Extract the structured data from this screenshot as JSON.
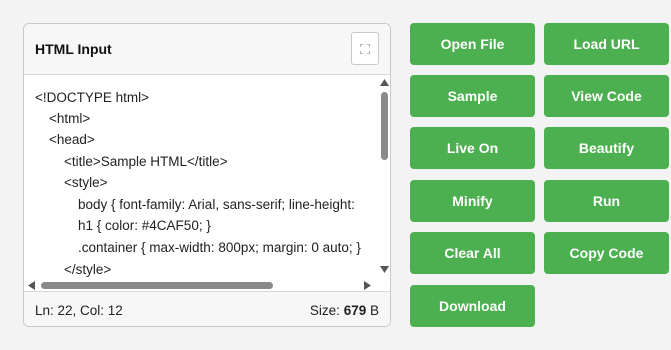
{
  "editor_panel": {
    "title": "HTML Input",
    "code_lines": [
      "<!DOCTYPE html>",
      "<html>",
      "<head>",
      "<title>Sample HTML</title>",
      "<style>",
      "body { font-family: Arial, sans-serif; line-height:",
      "h1 { color: #4CAF50; }",
      ".container { max-width: 800px; margin: 0 auto; }",
      "</style>"
    ],
    "status": {
      "cursor": "Ln: 22, Col: 12",
      "size_label": "Size:",
      "size_value": "679",
      "size_unit": "B"
    },
    "scroll": {
      "vertical_fraction": 0.0,
      "horizontal_fraction": 0.0
    }
  },
  "actions": {
    "open_file": "Open File",
    "load_url": "Load URL",
    "sample": "Sample",
    "view_code": "View Code",
    "live_on": "Live On",
    "beautify": "Beautify",
    "minify": "Minify",
    "run": "Run",
    "clear_all": "Clear All",
    "copy_code": "Copy Code",
    "download": "Download"
  },
  "colors": {
    "button_bg": "#4caf50",
    "button_text": "#ffffff",
    "scrollbar_thumb": "#8a8a8a"
  },
  "icons": {
    "expand": "expand-icon"
  }
}
